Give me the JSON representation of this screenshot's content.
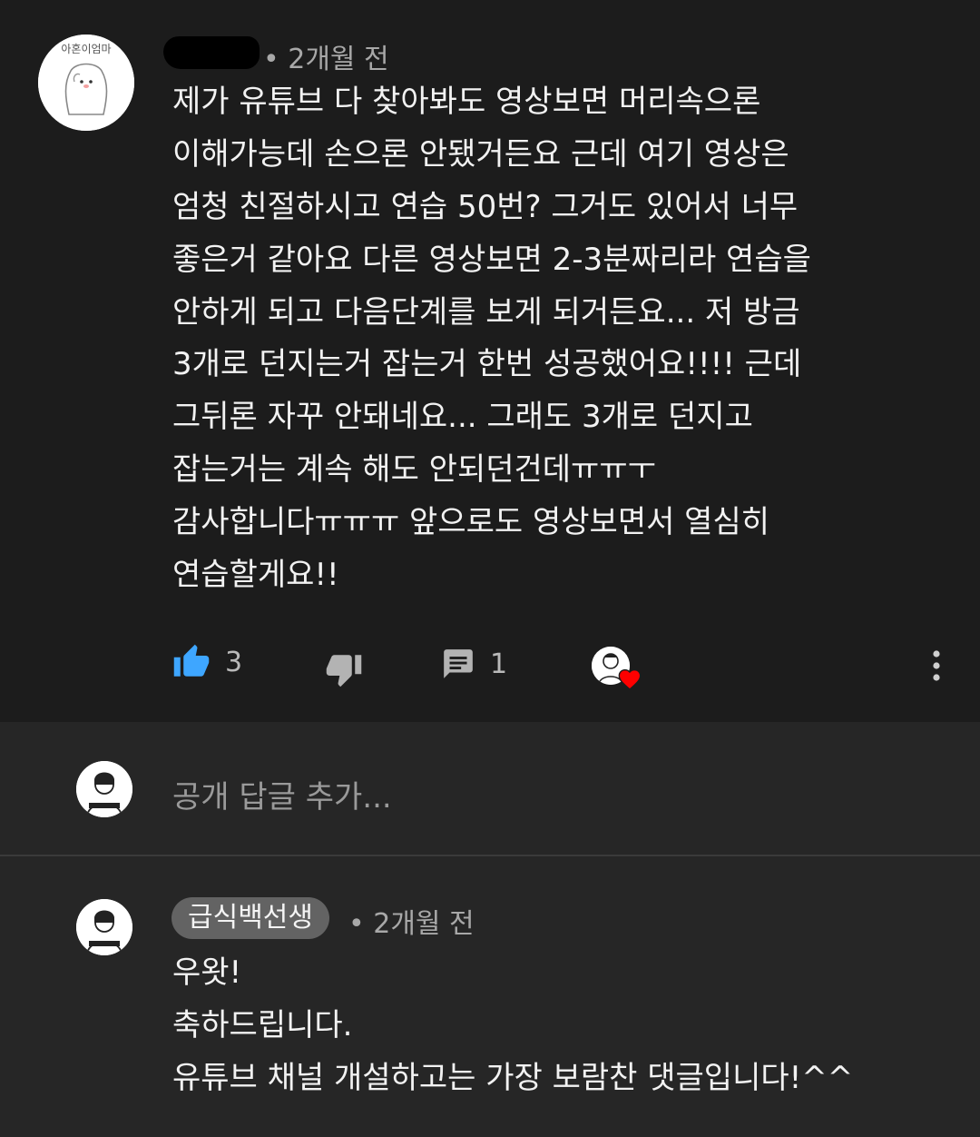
{
  "comment": {
    "timestamp": "• 2개월 전",
    "avatar_text": "아혼이엄마",
    "lines": [
      "제가 유튜브 다 찾아봐도 영상보면 머리속으론",
      "이해가능데 손으론 안됐거든요 근데 여기 영상은",
      "엄청 친절하시고 연습 50번? 그거도 있어서 너무",
      "좋은거 같아요 다른 영상보면 2-3분짜리라 연습을",
      "안하게 되고 다음단계를 보게 되거든요... 저 방금",
      "3개로 던지는거 잡는거 한번 성공했어요!!!! 근데",
      "그뒤론 자꾸 안돼네요... 그래도 3개로 던지고",
      "잡는거는 계속 해도 안되던건데ㅠㅠㅜ",
      "감사합니다ㅠㅠㅠ 앞으로도 영상보면서 열심히",
      "연습할게요!!"
    ],
    "like_count": "3",
    "reply_count": "1",
    "icons": {
      "like": "thumbs-up-icon",
      "dislike": "thumbs-down-icon",
      "reply": "comment-icon",
      "heart": "heart-icon",
      "more": "more-vertical-icon"
    },
    "colors": {
      "like_active": "#3ea6ff",
      "heart": "#ff0000"
    }
  },
  "reply_input": {
    "placeholder": "공개 답글 추가..."
  },
  "reply": {
    "author": "급식백선생",
    "timestamp": "• 2개월 전",
    "lines": [
      "우왓!",
      "축하드립니다.",
      "유튜브 채널 개설하고는 가장 보람찬 댓글입니다!^^"
    ]
  }
}
